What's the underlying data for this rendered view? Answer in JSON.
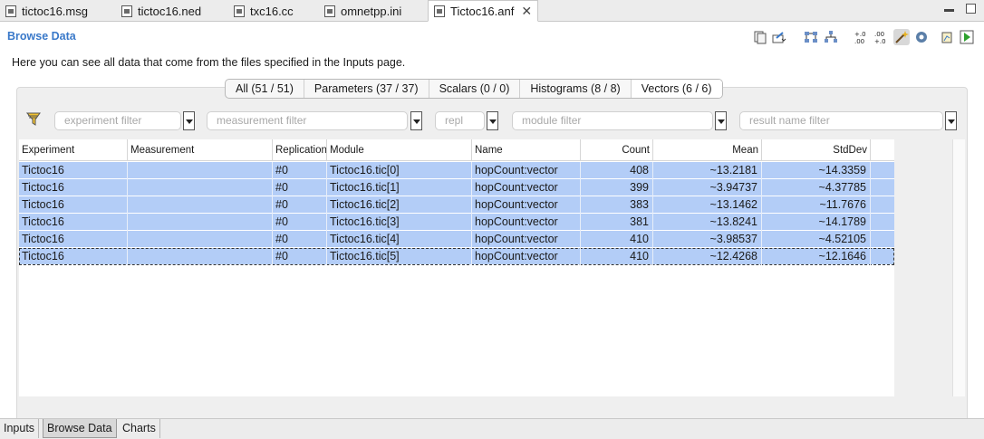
{
  "editor_tabs": [
    {
      "label": "tictoc16.msg"
    },
    {
      "label": "tictoc16.ned"
    },
    {
      "label": "txc16.cc"
    },
    {
      "label": "omnetpp.ini"
    },
    {
      "label": "Tictoc16.anf",
      "close": "✕"
    }
  ],
  "page": {
    "title": "Browse Data",
    "description": "Here you can see all data that come from the files specified in the Inputs page."
  },
  "toolbar_icons": [
    "copy-icon",
    "export-icon",
    "tree-icon",
    "hierarchy-icon",
    "precision-increase-icon",
    "precision-decrease-icon",
    "wand-icon",
    "gear-icon",
    "chart-icon",
    "run-icon"
  ],
  "toolbar_glyphs": {
    "precision_increase": "+.0\n.00",
    "precision_decrease": ".00\n+.0"
  },
  "filter_tabs": [
    {
      "label": "All (51 / 51)"
    },
    {
      "label": "Parameters (37 / 37)"
    },
    {
      "label": "Scalars (0 / 0)"
    },
    {
      "label": "Histograms (8 / 8)"
    },
    {
      "label": "Vectors (6 / 6)",
      "selected": true
    }
  ],
  "filters": {
    "experiment": "experiment filter",
    "measurement": "measurement filter",
    "replication": "repl",
    "module": "module filter",
    "result_name": "result name filter"
  },
  "columns": [
    "Experiment",
    "Measurement",
    "Replication",
    "Module",
    "Name",
    "Count",
    "Mean",
    "StdDev"
  ],
  "rows": [
    {
      "experiment": "Tictoc16",
      "measurement": "",
      "replication": "#0",
      "module": "Tictoc16.tic[0]",
      "name": "hopCount:vector",
      "count": "408",
      "mean": "~13.2181",
      "stddev": "~14.3359"
    },
    {
      "experiment": "Tictoc16",
      "measurement": "",
      "replication": "#0",
      "module": "Tictoc16.tic[1]",
      "name": "hopCount:vector",
      "count": "399",
      "mean": "~3.94737",
      "stddev": "~4.37785"
    },
    {
      "experiment": "Tictoc16",
      "measurement": "",
      "replication": "#0",
      "module": "Tictoc16.tic[2]",
      "name": "hopCount:vector",
      "count": "383",
      "mean": "~13.1462",
      "stddev": "~11.7676"
    },
    {
      "experiment": "Tictoc16",
      "measurement": "",
      "replication": "#0",
      "module": "Tictoc16.tic[3]",
      "name": "hopCount:vector",
      "count": "381",
      "mean": "~13.8241",
      "stddev": "~14.1789"
    },
    {
      "experiment": "Tictoc16",
      "measurement": "",
      "replication": "#0",
      "module": "Tictoc16.tic[4]",
      "name": "hopCount:vector",
      "count": "410",
      "mean": "~3.98537",
      "stddev": "~4.52105"
    },
    {
      "experiment": "Tictoc16",
      "measurement": "",
      "replication": "#0",
      "module": "Tictoc16.tic[5]",
      "name": "hopCount:vector",
      "count": "410",
      "mean": "~12.4268",
      "stddev": "~12.1646",
      "focused": true
    }
  ],
  "bottom_tabs": [
    {
      "label": "Inputs"
    },
    {
      "label": "Browse Data",
      "selected": true
    },
    {
      "label": "Charts"
    }
  ]
}
